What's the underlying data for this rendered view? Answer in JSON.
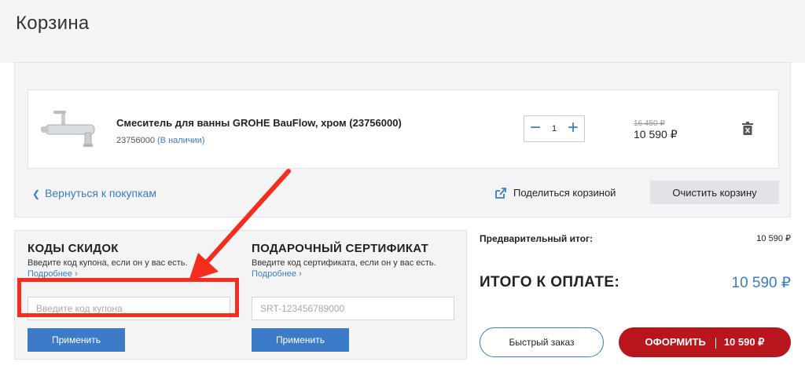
{
  "header": {
    "title": "Корзина"
  },
  "cart": {
    "items": [
      {
        "name": "Смеситель для ванны GROHE BauFlow, хром (23756000)",
        "sku": "23756000",
        "stock": "(В наличии)",
        "quantity": "1",
        "old_price": "16 450 ₽",
        "price": "10 590 ₽",
        "image_icon": "faucet-image"
      }
    ],
    "back_link": "Вернуться к покупкам",
    "share_label": "Поделиться корзиной",
    "clear_label": "Очистить корзину"
  },
  "coupon": {
    "title": "КОДЫ СКИДОК",
    "description": "Введите код купона, если он у вас есть.",
    "more": "Подробнее ›",
    "placeholder": "Введите код купона",
    "apply_label": "Применить"
  },
  "certificate": {
    "title": "ПОДАРОЧНЫЙ СЕРТИФИКАТ",
    "description": "Введите код сертификата, если он у вас есть.",
    "more": "Подробнее ›",
    "placeholder": "SRT-123456789000",
    "apply_label": "Применить"
  },
  "summary": {
    "subtotal_label": "Предварительный итог:",
    "subtotal_value": "10 590 ₽",
    "total_label": "ИТОГО К ОПЛАТЕ:",
    "total_value": "10 590 ₽",
    "quick_order_label": "Быстрый заказ",
    "checkout_label": "ОФОРМИТЬ",
    "checkout_price": "10 590 ₽"
  },
  "colors": {
    "accent_blue": "#3a7cc8",
    "checkout_red": "#b8151d",
    "annotation_red": "#f42d1e"
  }
}
